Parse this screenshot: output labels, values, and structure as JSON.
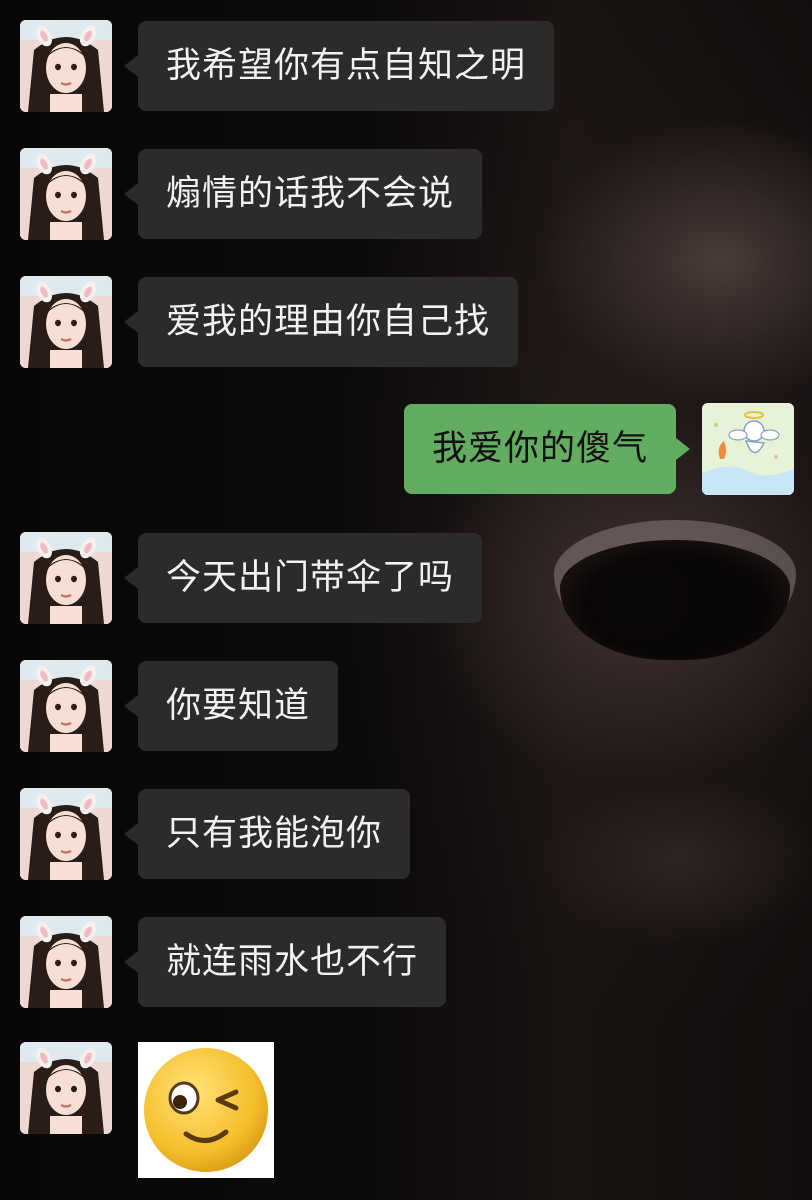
{
  "colors": {
    "bubble_received": "#2b2b2b",
    "bubble_sent": "#62ad5f",
    "text_received": "#f2f2f2",
    "text_sent": "#111111"
  },
  "contact_avatar": "girl-with-bunny-ears-avatar",
  "self_avatar": "angel-cartoon-avatar",
  "messages": [
    {
      "side": "received",
      "text": "我希望你有点自知之明"
    },
    {
      "side": "received",
      "text": "煽情的话我不会说"
    },
    {
      "side": "received",
      "text": "爱我的理由你自己找"
    },
    {
      "side": "sent",
      "text": "我爱你的傻气"
    },
    {
      "side": "received",
      "text": "今天出门带伞了吗"
    },
    {
      "side": "received",
      "text": "你要知道"
    },
    {
      "side": "received",
      "text": "只有我能泡你"
    },
    {
      "side": "received",
      "text": "就连雨水也不行"
    },
    {
      "side": "received",
      "sticker": "winking-smiley-emoji"
    }
  ]
}
